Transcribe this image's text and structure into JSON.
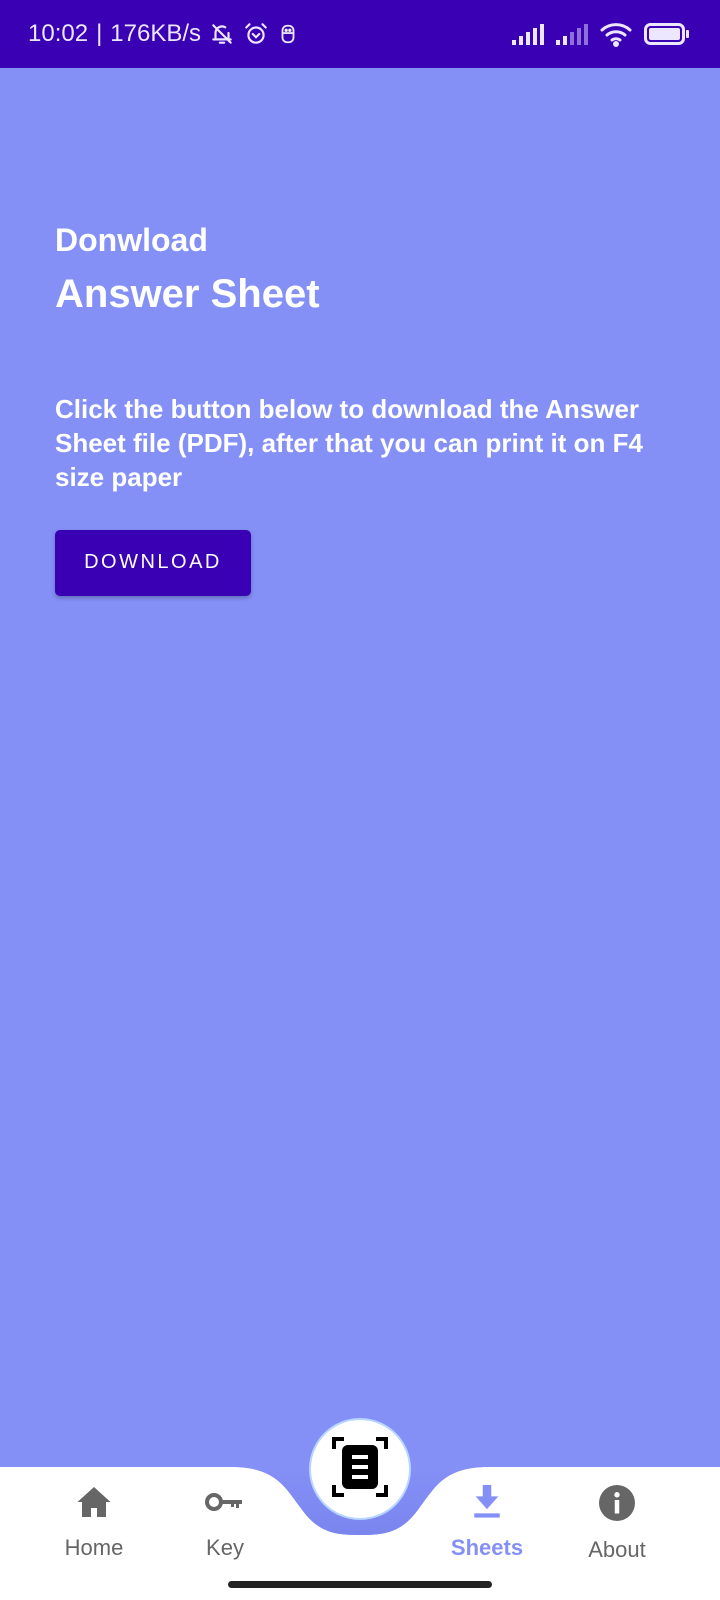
{
  "status_bar": {
    "time": "10:02",
    "separator": "|",
    "net_speed": "176KB/s",
    "left_icons": [
      "bell-off-icon",
      "alarm-icon",
      "app-notification-icon"
    ],
    "right_icons": [
      "signal-sim1-icon",
      "signal-sim2-icon",
      "wifi-icon",
      "battery-icon"
    ]
  },
  "main": {
    "subtitle": "Donwload",
    "title": "Answer Sheet",
    "description": "Click the button below to download the Answer Sheet file (PDF), after that you can print it on F4 size paper",
    "download_button": "DOWNLOAD"
  },
  "bottom_nav": {
    "items": [
      {
        "label": "Home",
        "icon": "home-icon",
        "active": false
      },
      {
        "label": "Key",
        "icon": "key-icon",
        "active": false
      },
      {
        "label": "Sheets",
        "icon": "download-icon",
        "active": true
      },
      {
        "label": "About",
        "icon": "info-icon",
        "active": false
      }
    ],
    "fab_icon": "document-scan-icon"
  },
  "colors": {
    "status_bar": "#3a00b3",
    "background": "#8490f6",
    "primary": "#3a00b3",
    "nav_active": "#8490f6",
    "nav_inactive": "#666666"
  }
}
